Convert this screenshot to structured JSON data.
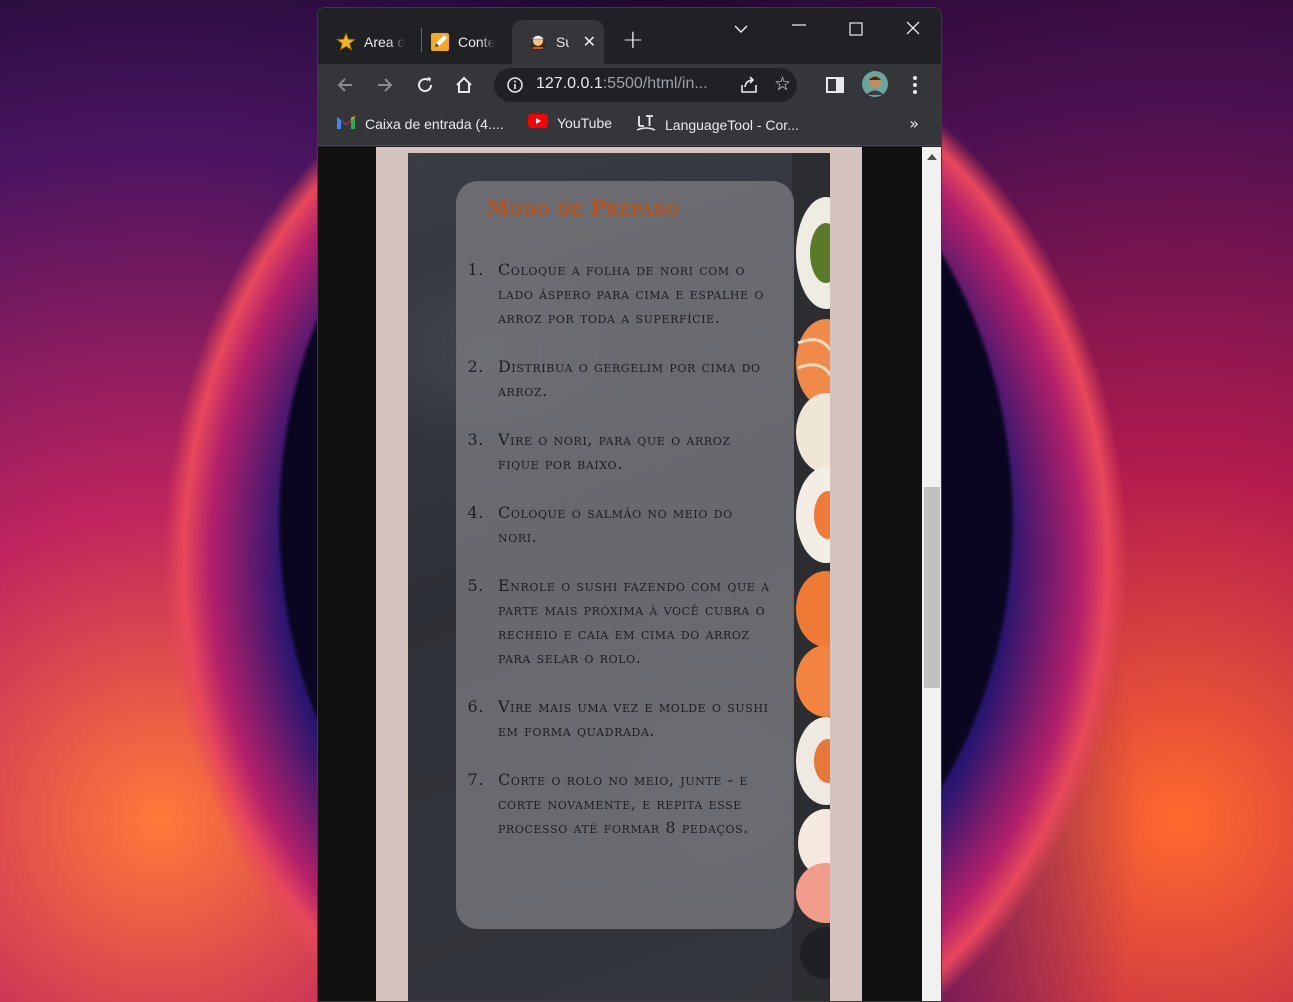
{
  "browser": {
    "tabs": [
      {
        "title": "Area d",
        "favicon": "star-icon",
        "active": false
      },
      {
        "title": "Conte",
        "favicon": "pencil-note-icon",
        "active": false
      },
      {
        "title": "Su",
        "favicon": "sushi-chef-icon",
        "active": true
      }
    ],
    "address": {
      "host": "127.0.0.1",
      "path": ":5500/html/in..."
    },
    "bookmarks": [
      {
        "label": "Caixa de entrada (4....",
        "icon": "gmail-icon"
      },
      {
        "label": "YouTube",
        "icon": "youtube-icon"
      },
      {
        "label": "LanguageTool - Cor...",
        "icon": "languagetool-icon"
      }
    ],
    "bookmarks_overflow": "»"
  },
  "page": {
    "section_title": "Modo de Preparo",
    "steps": [
      {
        "num": "1.",
        "text": "Coloque a folha de nori com o lado áspero para cima e espalhe o arroz por toda a superfície."
      },
      {
        "num": "2.",
        "text": "Distribua o gergelim por cima do arroz."
      },
      {
        "num": "3.",
        "text": "Vire o nori, para que o arroz fique por baixo."
      },
      {
        "num": "4.",
        "text": "Coloque o salmão no meio do nori."
      },
      {
        "num": "5.",
        "text": "Enrole o sushi fazendo com que a parte mais próxima à você cubra o recheio e caia em cima do arroz para selar o rolo."
      },
      {
        "num": "6.",
        "text": "Vire mais uma vez e molde o sushi em forma quadrada."
      },
      {
        "num": "7.",
        "text": "Corte o rolo no meio, junte - e corte novamente, e repita esse processo até formar 8 pedaços."
      }
    ]
  },
  "colors": {
    "title": "#b5541b",
    "card": "#808084",
    "page_bg": "#d4c3bf",
    "slate": "#2d3036"
  }
}
